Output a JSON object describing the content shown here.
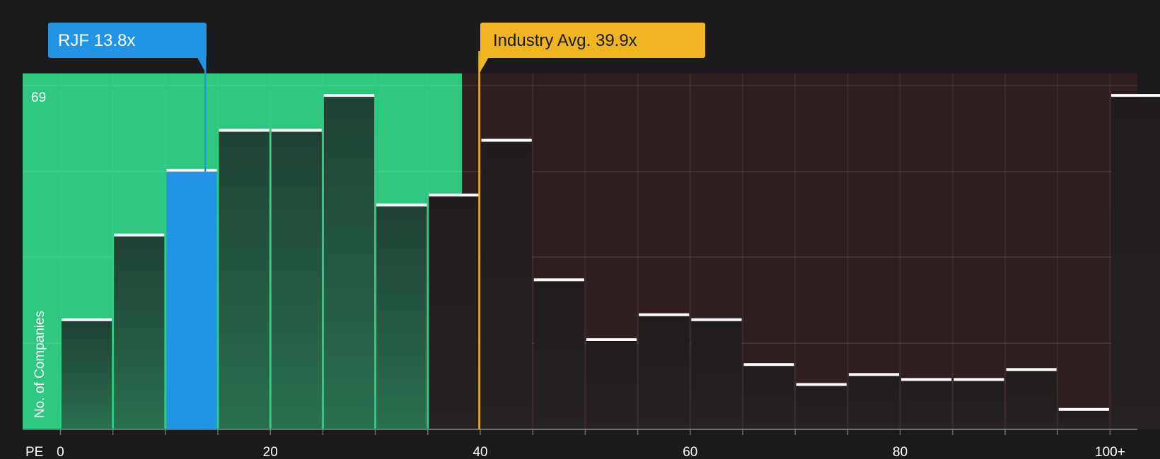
{
  "chart_data": {
    "type": "bar",
    "x_axis_label": "PE",
    "y_axis_label": "No. of Companies",
    "y_max_label": "69",
    "x_tick_labels": [
      "0",
      "20",
      "40",
      "60",
      "80",
      "100+"
    ],
    "x_ticks": [
      0,
      20,
      40,
      60,
      80,
      100
    ],
    "bin_width": 5,
    "bins_start": [
      0,
      5,
      10,
      15,
      20,
      25,
      30,
      35,
      40,
      45,
      50,
      55,
      60,
      65,
      70,
      75,
      80,
      85,
      90,
      95,
      100
    ],
    "values": [
      22,
      39,
      52,
      60,
      60,
      67,
      45,
      47,
      58,
      30,
      18,
      23,
      22,
      13,
      9,
      11,
      10,
      10,
      12,
      4,
      67
    ],
    "highlight_bin_index": 2,
    "xlim": [
      -3.6,
      102.6
    ],
    "ylim": [
      0,
      69
    ],
    "grid": true,
    "subject": {
      "label": "RJF 13.8x",
      "value": 13.8,
      "color": "#2394e4"
    },
    "industry": {
      "label": "Industry Avg. 39.9x",
      "value": 39.9,
      "color": "#efb420"
    },
    "colors": {
      "undervalued_zone": "#2fc77f",
      "overvalued_zone": "#2f1f21",
      "bar_in_green": "#234a38",
      "bar_in_red": "#231e1f",
      "bar_highlight": "#2394e4",
      "bar_cap": "#ffffff",
      "background": "#1b1b1d"
    }
  }
}
